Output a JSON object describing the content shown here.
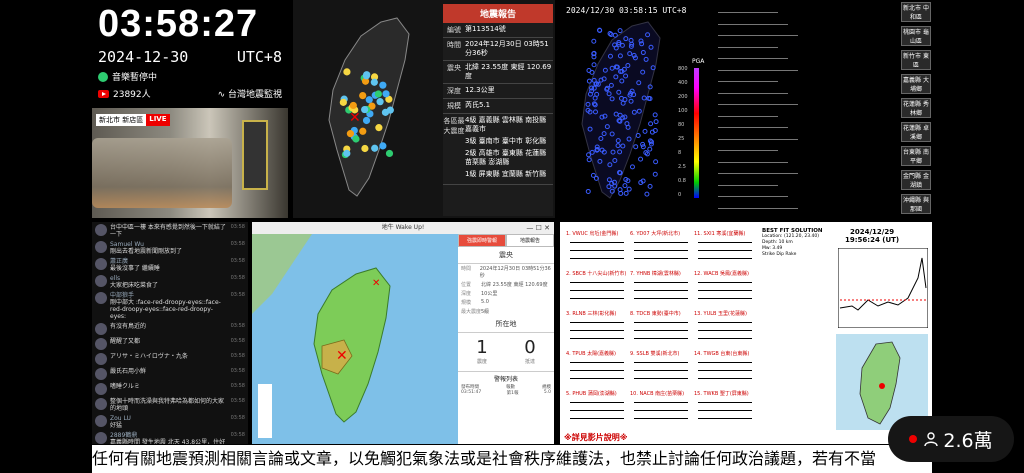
{
  "clock": {
    "time": "03:58:27",
    "date": "2024-12-30",
    "tz": "UTC+8",
    "music_status": "音樂暫停中",
    "viewers": "23892人",
    "brand": "台灣地震監視"
  },
  "camera": {
    "location": "新北市 新店區",
    "live": "LIVE"
  },
  "report": {
    "title": "地震報告",
    "rows": [
      {
        "key": "編號",
        "val": "第113514號"
      },
      {
        "key": "時間",
        "val": "2024年12月30日 03時51分36秒"
      },
      {
        "key": "震央",
        "val": "北緯 23.55度 東經 120.69度"
      },
      {
        "key": "深度",
        "val": "12.3公里"
      },
      {
        "key": "規模",
        "val": "芮氏5.1"
      }
    ],
    "intensity_key": "各區最大震度",
    "intensity": [
      "4級 嘉義縣 雲林縣 南投縣 嘉義市",
      "3級 臺南市 臺中市 彰化縣",
      "2級 高雄市 臺東縣 花蓮縣 苗栗縣 澎湖縣",
      "1級 屏東縣 宜蘭縣 新竹縣"
    ]
  },
  "pga": {
    "timestamp": "2024/12/30 03:58:15 UTC+8",
    "label": "PGA",
    "ticks": [
      "800",
      "400",
      "200",
      "100",
      "80",
      "25",
      "8",
      "2.5",
      "0.8",
      "0"
    ]
  },
  "stations": [
    "新北市 中和區",
    "桃園市 龜山區",
    "新竹市 東區",
    "嘉義縣 大埔鄉",
    "花蓮縣 秀林鄉",
    "花蓮縣 卓溪鄉",
    "台東縣 南平鄉",
    "金門縣 金湖鎮",
    "沖繩縣 與那國"
  ],
  "chat": [
    {
      "name": "",
      "text": "台中中區一樓 本來有感覺到然後一下就結了一下",
      "time": "03:58"
    },
    {
      "name": "Samuel Wu",
      "text": "剛出去看地震新聞剛放到了",
      "time": "03:58"
    },
    {
      "name": "蕭正廣",
      "text": "最後沒事了 繼續睡",
      "time": "03:58"
    },
    {
      "name": "ells",
      "text": "大家把床吃菜食了",
      "time": "03:58"
    },
    {
      "name": "中部狼手",
      "text": "剛中部大 :face-red-droopy-eyes::face-red-droopy-eyes::face-red-droopy-eyes:",
      "time": "03:58"
    },
    {
      "name": "",
      "text": "有沒有鳥近的",
      "time": "03:58"
    },
    {
      "name": "",
      "text": "醒醒了又都",
      "time": "03:58"
    },
    {
      "name": "",
      "text": "アリサ・ミハイロヴナ・九条",
      "time": "03:58"
    },
    {
      "name": "",
      "text": "嚴氏石用小鮮",
      "time": "03:58"
    },
    {
      "name": "",
      "text": "嗜睡クルミ",
      "time": "03:58"
    },
    {
      "name": "",
      "text": "整個十時而洗澡與我特弗哈為都如何的大家的地頭",
      "time": "03:58"
    },
    {
      "name": "Zou LU",
      "text": "好猛",
      "time": "03:58"
    },
    {
      "name": "2889鶴鼎",
      "text": "嘉義縣時間 發生地震 北天 43.8公里，住好嘉義縣梅山鄉地震深度：12.3公里芮氏規模：5.1",
      "time": "03:58"
    }
  ],
  "wakeup": {
    "window_title": "地牛 Wake Up!",
    "tabs": [
      "強震即時警報",
      "地震報告"
    ],
    "epicenter_head": "震央",
    "rows": [
      {
        "k": "時間",
        "v": "2024年12月30日 03時51分36秒"
      },
      {
        "k": "位置",
        "v": "北緯 23.55度 東經 120.69度"
      },
      {
        "k": "深度",
        "v": "10公里"
      },
      {
        "k": "規模",
        "v": "5.0"
      },
      {
        "k": "最大震度",
        "v": "5級"
      }
    ],
    "local_head": "所在地",
    "local_intensity": "1",
    "arrival": "0",
    "local_sub": [
      "震度",
      "抵達"
    ],
    "alerts_title": "警報列表",
    "alerts": [
      {
        "a": "發布時間",
        "b": "報數",
        "c": "規模"
      },
      {
        "a": "03:51:47",
        "b": "第1報",
        "c": "5.0"
      }
    ]
  },
  "seismo": {
    "stations": [
      "1. VWUC 烏坵(金門縣)",
      "6. YD07 大坪(新北市)",
      "11. SXI1 寒溪(宜蘭縣)",
      "2. SBCB 十八尖山(新竹市)",
      "7. YHNB 樟湖(雲林縣)",
      "12. WACB 吳鳳(嘉義縣)",
      "3. RLNB 三林(彰化縣)",
      "8. TDCB 東勢(臺中市)",
      "13. YULB 玉里(花蓮縣)",
      "4. TPUB 太陽(嘉義縣)",
      "9. SSLB 雙溪(新北市)",
      "14. TWGB 台東(台東縣)",
      "5. PHUB 蒲岡(澎湖縣)",
      "10. NACB 南庄(苗栗縣)",
      "15. TWKB 墾丁(屏東縣)"
    ],
    "fit_title": "BEST FIT SOLUTION",
    "fit_lines": [
      "Location: (121.20, 23.40)",
      "Depth: 10 km",
      "Mw: 3.49",
      "Strike  Dip  Rake"
    ],
    "fit_date": "2024/12/29",
    "fit_time": "19:56:24 (UT)",
    "note": "※詳見影片說明※"
  },
  "ticker": "任何有關地震預測相關言論或文章，以免觸犯氣象法或是社會秩序維護法，也禁止討論任何政治議題，若有不當",
  "viewer_badge": {
    "count": "2.6萬"
  }
}
